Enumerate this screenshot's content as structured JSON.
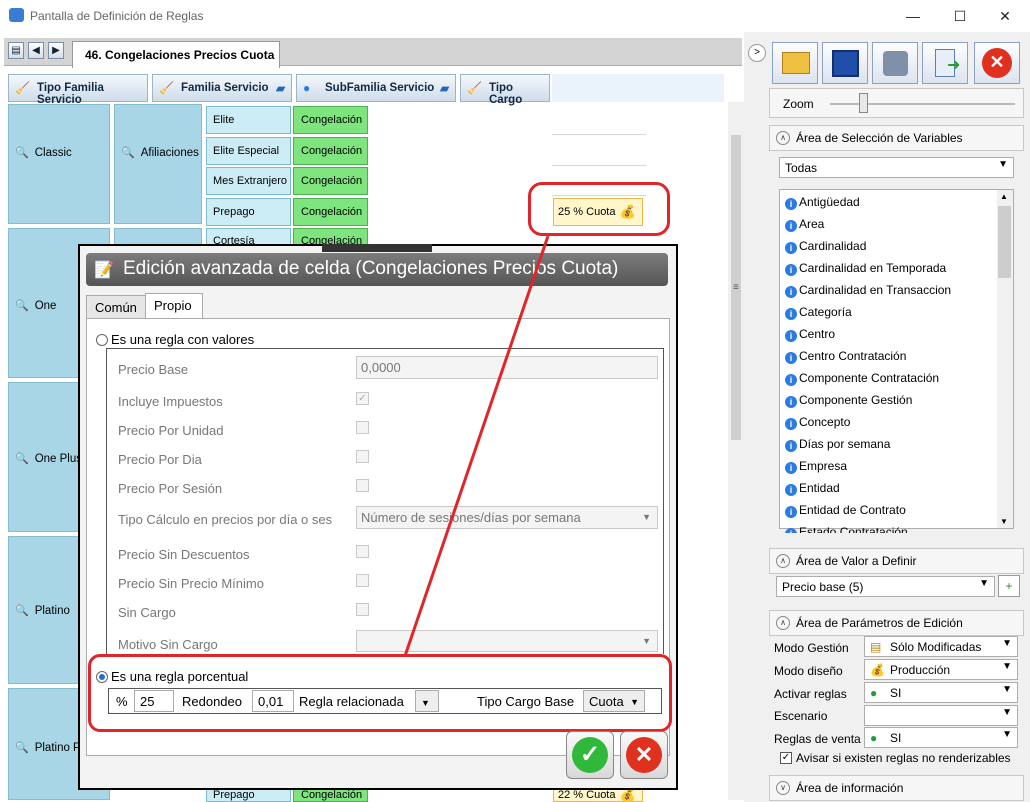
{
  "window": {
    "title": "Pantalla de Definición de Reglas",
    "minimize": "—",
    "maximize": "☐",
    "close": "✕"
  },
  "doc_tab": "46. Congelaciones Precios Cuota",
  "headers": [
    "Tipo Familia Servicio",
    "Familia Servicio",
    "SubFamilia Servicio",
    "Tipo Cargo"
  ],
  "families": [
    "Classic",
    "One",
    "One Plus",
    "Platino",
    "Platino P"
  ],
  "familia_servicio": "Afiliaciones",
  "subfamilias": [
    "Elite",
    "Elite Especial",
    "Mes Extranjero",
    "Prepago",
    "Cortesía"
  ],
  "bottom_subfamilia": "Prepago",
  "congelacion": "Congelación",
  "pct_cells": [
    "25 % Cuota",
    "22 % Cuota"
  ],
  "right_panel": {
    "zoom_label": "Zoom",
    "sel_title": "Área de Selección de Variables",
    "filter": "Todas",
    "variables": [
      "Antigüedad",
      "Area",
      "Cardinalidad",
      "Cardinalidad en Temporada",
      "Cardinalidad en Transaccion",
      "Categoría",
      "Centro",
      "Centro Contratación",
      "Componente Contratación",
      "Componente Gestión",
      "Concepto",
      "Días por semana",
      "Empresa",
      "Entidad",
      "Entidad de Contrato",
      "Estado Contratación"
    ],
    "val_title": "Área de Valor a Definir",
    "val_combo": "Precio base (5)",
    "param_title": "Área de Parámetros de Edición",
    "params": [
      {
        "label": "Modo Gestión",
        "value": "Sólo Modificadas"
      },
      {
        "label": "Modo diseño",
        "value": "Producción"
      },
      {
        "label": "Activar reglas",
        "value": "SI"
      },
      {
        "label": "Escenario",
        "value": ""
      },
      {
        "label": "Reglas de venta",
        "value": "SI"
      }
    ],
    "warn_check": "Avisar si existen reglas no renderizables",
    "info_title": "Área de información"
  },
  "dialog": {
    "title": "Edición avanzada de celda (Congelaciones Precios Cuota)",
    "tab_common": "Común",
    "tab_prop": "Propio",
    "radio_values": "Es una regla con valores",
    "fields": [
      "Precio Base",
      "Incluye Impuestos",
      "Precio Por Unidad",
      "Precio Por Dia",
      "Precio Por Sesión",
      "Tipo Cálculo en precios por día o ses",
      "Precio Sin Descuentos",
      "Precio Sin Precio Mínimo",
      "Sin Cargo",
      "Motivo Sin Cargo"
    ],
    "precio_base": "0,0000",
    "tipo_calculo": "Número de sesiones/días por semana",
    "radio_pct": "Es una regla porcentual",
    "pct_symbol": "%",
    "pct_value": "25",
    "redondeo_label": "Redondeo",
    "redondeo_value": "0,01",
    "regla_label": "Regla relacionada",
    "tipo_base_label": "Tipo Cargo Base",
    "tipo_base_value": "Cuota"
  }
}
